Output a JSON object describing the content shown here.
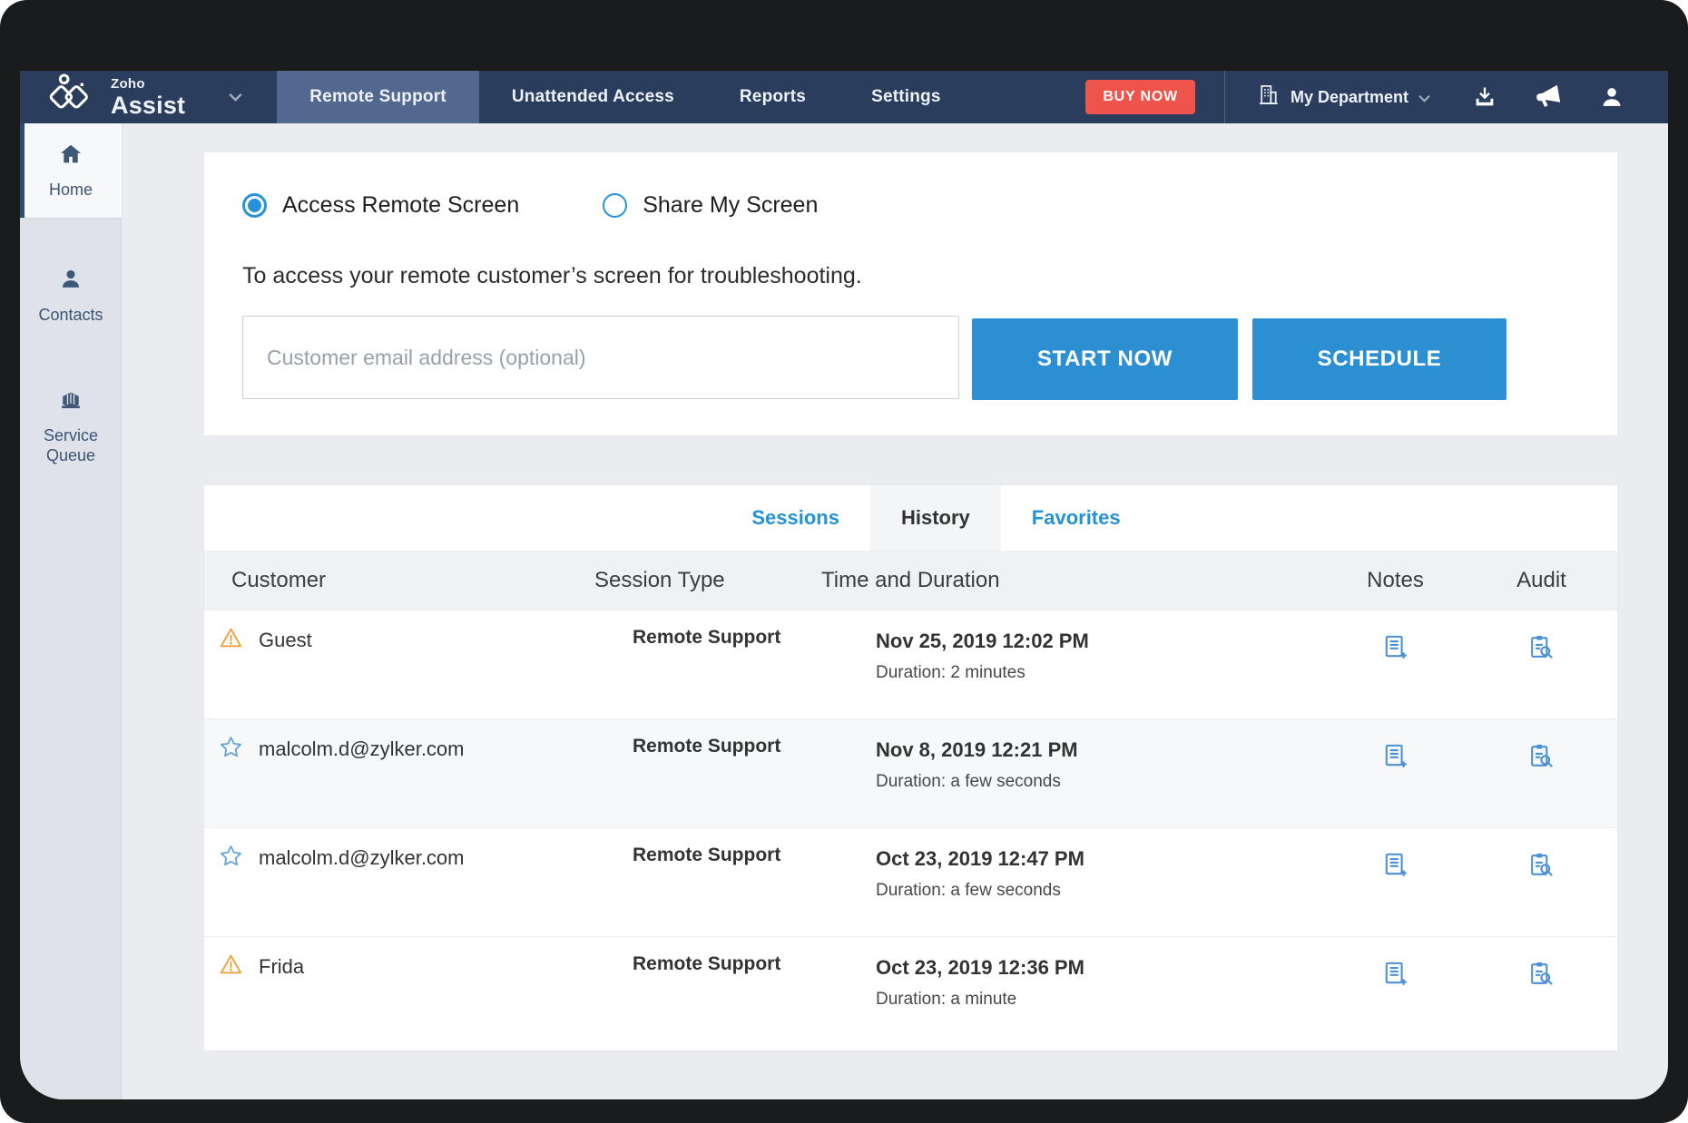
{
  "colors": {
    "navbar_bg": "#2b3d5c",
    "navbar_active_tab": "#52688f",
    "buy_now_red": "#ee544b",
    "accent_blue": "#2792d9",
    "button_blue": "#2b8fd2",
    "link_blue": "#2492d3",
    "sidebar_icon": "#3e5878",
    "warning_orange": "#eda13f",
    "star_blue": "#64a4dc",
    "row_icon_blue": "#4a90d9"
  },
  "navbar": {
    "brand": {
      "top": "Zoho",
      "bottom": "Assist"
    },
    "tabs": [
      {
        "label": "Remote Support",
        "active": true
      },
      {
        "label": "Unattended Access",
        "active": false
      },
      {
        "label": "Reports",
        "active": false
      },
      {
        "label": "Settings",
        "active": false
      }
    ],
    "buy_now_label": "BUY NOW",
    "department_label": "My Department"
  },
  "sidebar": {
    "items": [
      {
        "label": "Home",
        "active": true
      },
      {
        "label": "Contacts",
        "active": false
      },
      {
        "label": "Service Queue",
        "active": false
      }
    ]
  },
  "launcher": {
    "radio_access": "Access Remote Screen",
    "radio_share": "Share My Screen",
    "description": "To access your remote customer’s screen for troubleshooting.",
    "email_placeholder": "Customer email address (optional)",
    "start_label": "START NOW",
    "schedule_label": "SCHEDULE"
  },
  "sessions_panel": {
    "tabs": {
      "sessions": "Sessions",
      "history": "History",
      "favorites": "Favorites"
    },
    "active_tab": "History",
    "columns": {
      "customer": "Customer",
      "type": "Session Type",
      "time": "Time and Duration",
      "notes": "Notes",
      "audit": "Audit"
    },
    "rows": [
      {
        "icon": "warning-icon",
        "customer": "Guest",
        "type": "Remote Support",
        "time": "Nov 25, 2019 12:02 PM",
        "duration": "Duration: 2 minutes"
      },
      {
        "icon": "star-icon",
        "customer": "malcolm.d@zylker.com",
        "type": "Remote Support",
        "time": "Nov 8, 2019 12:21 PM",
        "duration": "Duration: a few seconds"
      },
      {
        "icon": "star-icon",
        "customer": "malcolm.d@zylker.com",
        "type": "Remote Support",
        "time": "Oct 23, 2019 12:47 PM",
        "duration": "Duration: a few seconds"
      },
      {
        "icon": "warning-icon",
        "customer": "Frida",
        "type": "Remote Support",
        "time": "Oct 23, 2019 12:36 PM",
        "duration": "Duration: a minute"
      }
    ]
  }
}
